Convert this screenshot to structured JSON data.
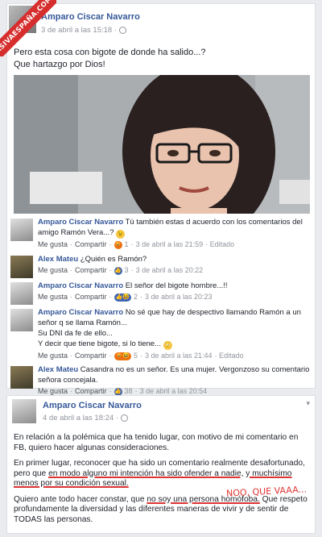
{
  "watermark": "ASIVAESPAÑA.COM",
  "post1": {
    "author": "Amparo Ciscar Navarro",
    "time": "3 de abril a las 15:18 ·",
    "line1": "Pero esta cosa con bigote de donde ha salido...?",
    "line2": "Que hartazgo por Dios!"
  },
  "comments": [
    {
      "author": "Amparo Ciscar Navarro",
      "avatar": "amp",
      "text": "Tú también estas d acuerdo con los comentarios del amigo Ramón Vera...?",
      "emoji": "😉",
      "reactions": "😡",
      "count": "1",
      "time": "3 de abril a las 21:59",
      "extra": "· Editado"
    },
    {
      "author": "Alex Mateu",
      "avatar": "alex",
      "text": "¿Quién es Ramón?",
      "reactions": "👍",
      "count": "3",
      "time": "3 de abril a las 20:22",
      "extra": ""
    },
    {
      "author": "Amparo Ciscar Navarro",
      "avatar": "amp",
      "text": "El señor del bigote hombre...!!",
      "reactions": "👍😆",
      "count": "2",
      "time": "3 de abril a las 20:23",
      "extra": ""
    },
    {
      "author": "Amparo Ciscar Navarro",
      "avatar": "amp",
      "text": "No sé que hay de despectivo llamando Ramón a un señor q se llama Ramón...",
      "text2": "Su DNI da fe de ello...",
      "text3": "Y decir que tiene bigote, si lo tiene...",
      "emoji": "😳",
      "reactions": "😡😆",
      "count": "5",
      "time": "3 de abril a las 21:44",
      "extra": "· Editado"
    },
    {
      "author": "Alex Mateu",
      "avatar": "alex",
      "text": "Casandra no es un señor. Es una mujer. Vergonzoso su comentario señora concejala.",
      "reactions": "👍",
      "count": "38",
      "time": "3 de abril a las 20:54",
      "extra": ""
    }
  ],
  "comment_actions": {
    "like": "Me gusta",
    "share": "Compartir"
  },
  "post2": {
    "author": "Amparo Ciscar Navarro",
    "time": "4 de abril a las 18:24 ·",
    "p1": "En relación a la polémica que ha tenido lugar, con motivo de mi comentario en FB, quiero hacer algunas consideraciones.",
    "p2_a": "En primer lugar, reconocer que ha sido un comentario realmente desafortunado, pero que ",
    "p2_b": "en modo alguno mi intención ha sido ofender a nadie, y muchísimo menos por su condición sexual.",
    "p3_a": "Quiero ante todo hacer constar, que ",
    "p3_b": "no soy una persona homófoba.",
    "p3_c": " Que respeto profundamente la diversidad y las diferentes maneras de vivir y de sentir de TODAS las personas."
  },
  "annotation": "NOO, QUE VAAA..."
}
